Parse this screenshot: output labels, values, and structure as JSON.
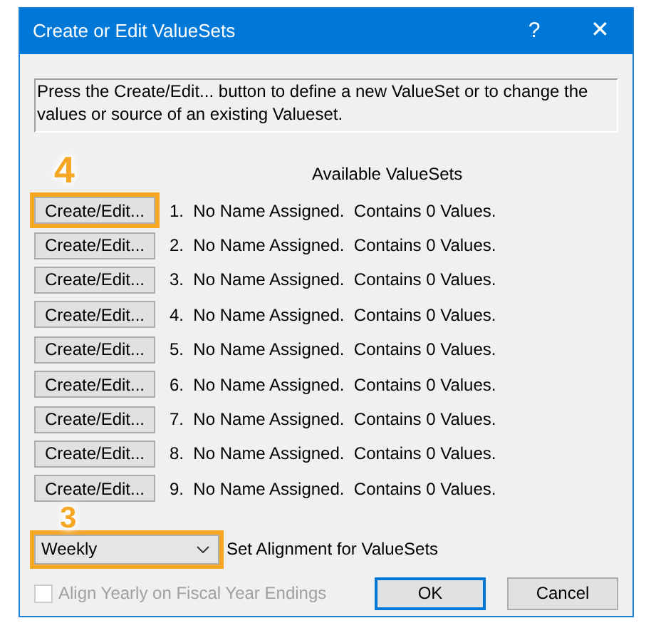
{
  "window": {
    "title": "Create or Edit ValueSets",
    "help": "?",
    "close": "✕"
  },
  "description": "Press the Create/Edit... button to define a new ValueSet or to change the values or source of an existing Valueset.",
  "list_heading": "Available ValueSets",
  "rows": [
    {
      "button": "Create/Edit...",
      "text": "1.  No Name Assigned.  Contains 0 Values.",
      "highlighted": true,
      "badge": "4"
    },
    {
      "button": "Create/Edit...",
      "text": "2.  No Name Assigned.  Contains 0 Values.",
      "highlighted": false
    },
    {
      "button": "Create/Edit...",
      "text": "3.  No Name Assigned.  Contains 0 Values.",
      "highlighted": false
    },
    {
      "button": "Create/Edit...",
      "text": "4.  No Name Assigned.  Contains 0 Values.",
      "highlighted": false
    },
    {
      "button": "Create/Edit...",
      "text": "5.  No Name Assigned.  Contains 0 Values.",
      "highlighted": false
    },
    {
      "button": "Create/Edit...",
      "text": "6.  No Name Assigned.  Contains 0 Values.",
      "highlighted": false
    },
    {
      "button": "Create/Edit...",
      "text": "7.  No Name Assigned.  Contains 0 Values.",
      "highlighted": false
    },
    {
      "button": "Create/Edit...",
      "text": "8.  No Name Assigned.  Contains 0 Values.",
      "highlighted": false
    },
    {
      "button": "Create/Edit...",
      "text": "9.  No Name Assigned.  Contains 0 Values.",
      "highlighted": false
    }
  ],
  "alignment": {
    "value": "Weekly",
    "label": "Set Alignment for ValueSets",
    "highlighted": true,
    "badge": "3"
  },
  "checkbox": {
    "label": "Align Yearly on Fiscal Year Endings",
    "checked": false,
    "disabled": true
  },
  "buttons": [
    {
      "label": "OK",
      "default": true
    },
    {
      "label": "Cancel",
      "default": false
    }
  ]
}
